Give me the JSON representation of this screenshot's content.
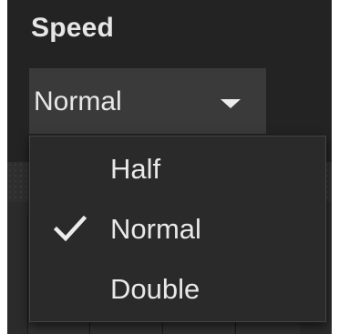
{
  "speed": {
    "label": "Speed",
    "selected": "Normal",
    "options": [
      {
        "label": "Half",
        "checked": false
      },
      {
        "label": "Normal",
        "checked": true
      },
      {
        "label": "Double",
        "checked": false
      }
    ]
  },
  "icons": {
    "dropdown_arrow": "chevron-down-icon",
    "selected_mark": "check-icon"
  },
  "colors": {
    "panel_bg": "#232323",
    "dropdown_bg": "#3a3a3a",
    "menu_bg": "#2a2a2a",
    "text": "#e8e8e8"
  }
}
